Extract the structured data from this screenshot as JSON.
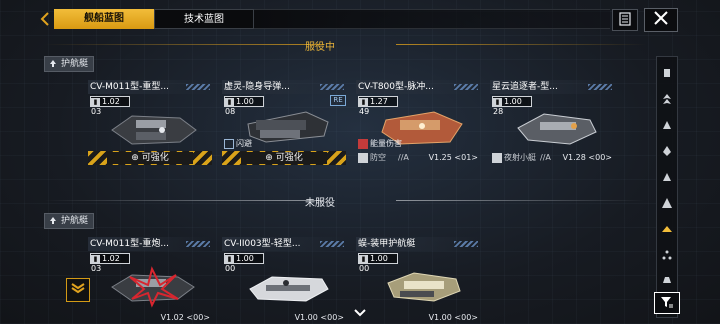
{
  "tabs": [
    {
      "label": "舰船蓝图",
      "active": true
    },
    {
      "label": "技术蓝图",
      "active": false
    }
  ],
  "icons": {
    "document": "document-icon",
    "close": "close-icon",
    "filter": "filter-icon"
  },
  "sections": {
    "active": {
      "title": "服役中",
      "subcategory": "护航艇"
    },
    "inactive": {
      "title": "未服役",
      "subcategory": "护航艇"
    }
  },
  "active_cards": [
    {
      "name": "CV-M011型-重型...",
      "level": "1.02",
      "level_suffix": "03",
      "strip": "可强化"
    },
    {
      "name": "虚灵-隐身导弹...",
      "level": "1.00",
      "level_suffix": "08",
      "re": "RE",
      "flash": "闪避",
      "strip": "可强化"
    },
    {
      "name": "CV-T800型-脉冲...",
      "level": "1.27",
      "level_suffix": "49",
      "warn": "能量伤害",
      "stat_label": "防空",
      "stat_class": "//A",
      "version": "V1.25 <01>"
    },
    {
      "name": "星云追逐者-型...",
      "level": "1.00",
      "level_suffix": "28",
      "stat_label": "夜射小艇",
      "stat_class": "//A",
      "version": "V1.28 <00>"
    }
  ],
  "inactive_cards": [
    {
      "name": "CV-M011型-重炮...",
      "level": "1.02",
      "level_suffix": "03",
      "version": "V1.02 <00>"
    },
    {
      "name": "CV-II003型-轻型...",
      "level": "1.00",
      "level_suffix": "00",
      "version": "V1.00 <00>"
    },
    {
      "name": "蜈-装甲护航艇",
      "level": "1.00",
      "level_suffix": "00",
      "version": "V1.00 <00>"
    }
  ],
  "colors": {
    "accent": "#f2bd3a",
    "hazard": "#d9a31a",
    "warn": "#c43b3b"
  }
}
